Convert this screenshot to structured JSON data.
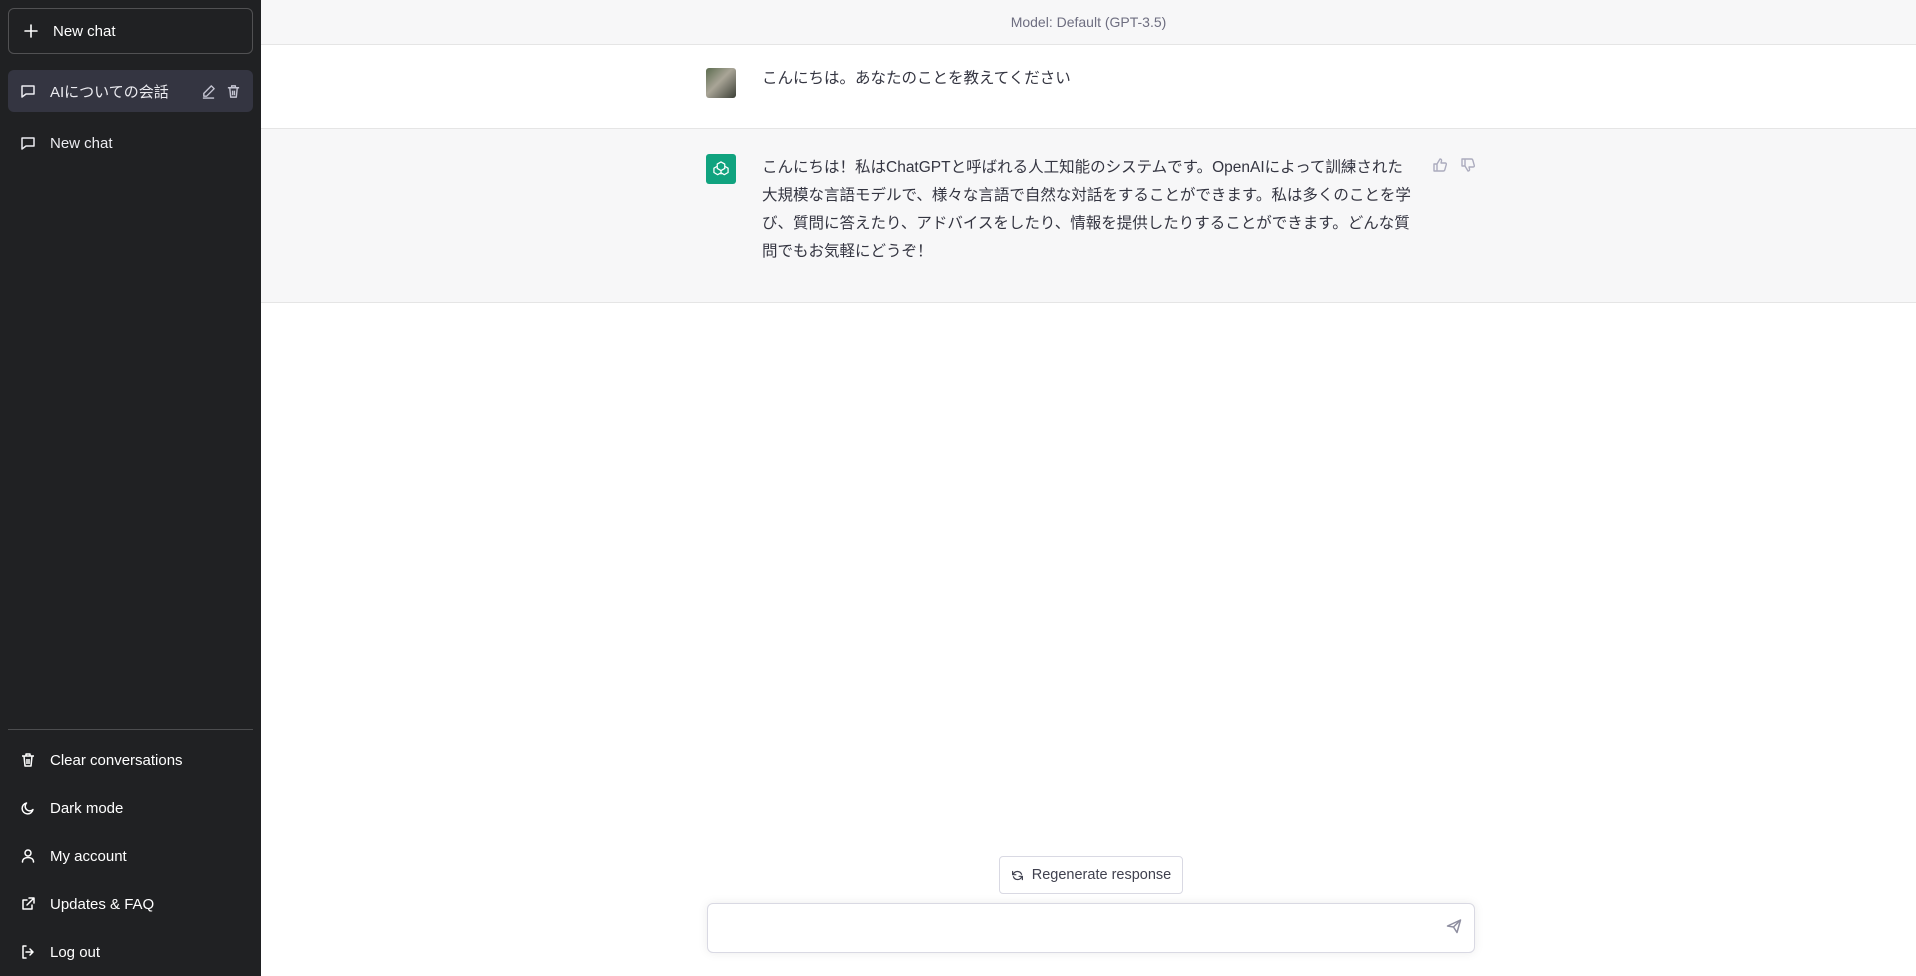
{
  "sidebar": {
    "new_chat_label": "New chat",
    "chats": [
      {
        "label": "AIについての会話",
        "active": true
      },
      {
        "label": "New chat",
        "active": false
      }
    ],
    "bottom_items": [
      {
        "label": "Clear conversations",
        "icon": "trash-icon"
      },
      {
        "label": "Dark mode",
        "icon": "moon-icon"
      },
      {
        "label": "My account",
        "icon": "user-icon"
      },
      {
        "label": "Updates & FAQ",
        "icon": "external-link-icon"
      },
      {
        "label": "Log out",
        "icon": "logout-icon"
      }
    ]
  },
  "main": {
    "model_label": "Model: Default (GPT-3.5)",
    "messages": [
      {
        "role": "user",
        "text": "こんにちは。あなたのことを教えてください"
      },
      {
        "role": "assistant",
        "text": "こんにちは！私はChatGPTと呼ばれる人工知能のシステムです。OpenAIによって訓練された大規模な言語モデルで、様々な言語で自然な対話をすることができます。私は多くのことを学び、質問に答えたり、アドバイスをしたり、情報を提供したりすることができます。どんな質問でもお気軽にどうぞ！"
      }
    ],
    "regenerate_label": "Regenerate response",
    "composer_value": ""
  },
  "colors": {
    "sidebar_bg": "#202123",
    "active_chat_bg": "#343541",
    "assistant_row_bg": "#f7f7f8",
    "brand_green": "#10a37f"
  }
}
